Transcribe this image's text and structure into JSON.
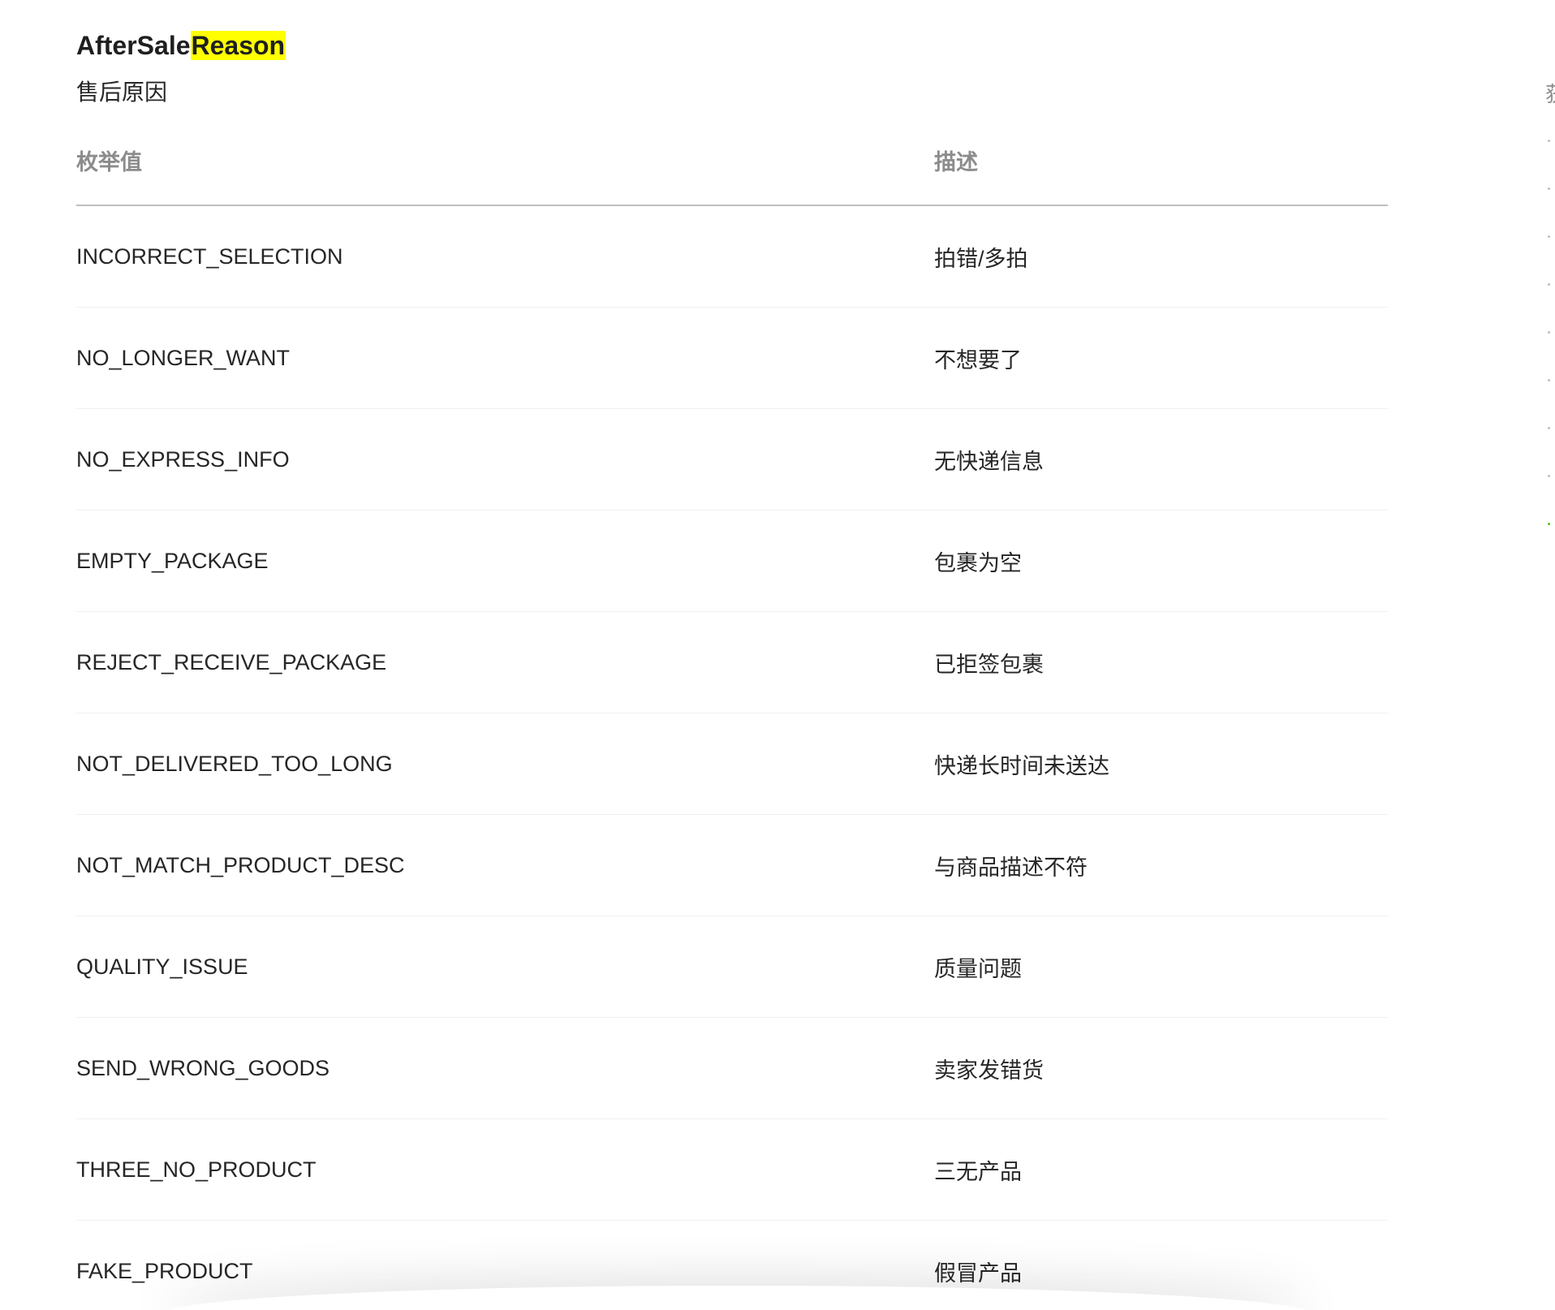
{
  "doc": {
    "title_prefix": "AfterSale",
    "title_highlight": "Reason",
    "subtitle": "售后原因"
  },
  "table": {
    "headers": [
      "枚举值",
      "描述"
    ],
    "rows": [
      {
        "value": "INCORRECT_SELECTION",
        "desc": "拍错/多拍"
      },
      {
        "value": "NO_LONGER_WANT",
        "desc": "不想要了"
      },
      {
        "value": "NO_EXPRESS_INFO",
        "desc": "无快递信息"
      },
      {
        "value": "EMPTY_PACKAGE",
        "desc": "包裹为空"
      },
      {
        "value": "REJECT_RECEIVE_PACKAGE",
        "desc": "已拒签包裹"
      },
      {
        "value": "NOT_DELIVERED_TOO_LONG",
        "desc": "快递长时间未送达"
      },
      {
        "value": "NOT_MATCH_PRODUCT_DESC",
        "desc": "与商品描述不符"
      },
      {
        "value": "QUALITY_ISSUE",
        "desc": "质量问题"
      },
      {
        "value": "SEND_WRONG_GOODS",
        "desc": "卖家发错货"
      },
      {
        "value": "THREE_NO_PRODUCT",
        "desc": "三无产品"
      },
      {
        "value": "FAKE_PRODUCT",
        "desc": "假冒产品"
      }
    ]
  },
  "side_nav": {
    "partial_glyph": "获"
  }
}
